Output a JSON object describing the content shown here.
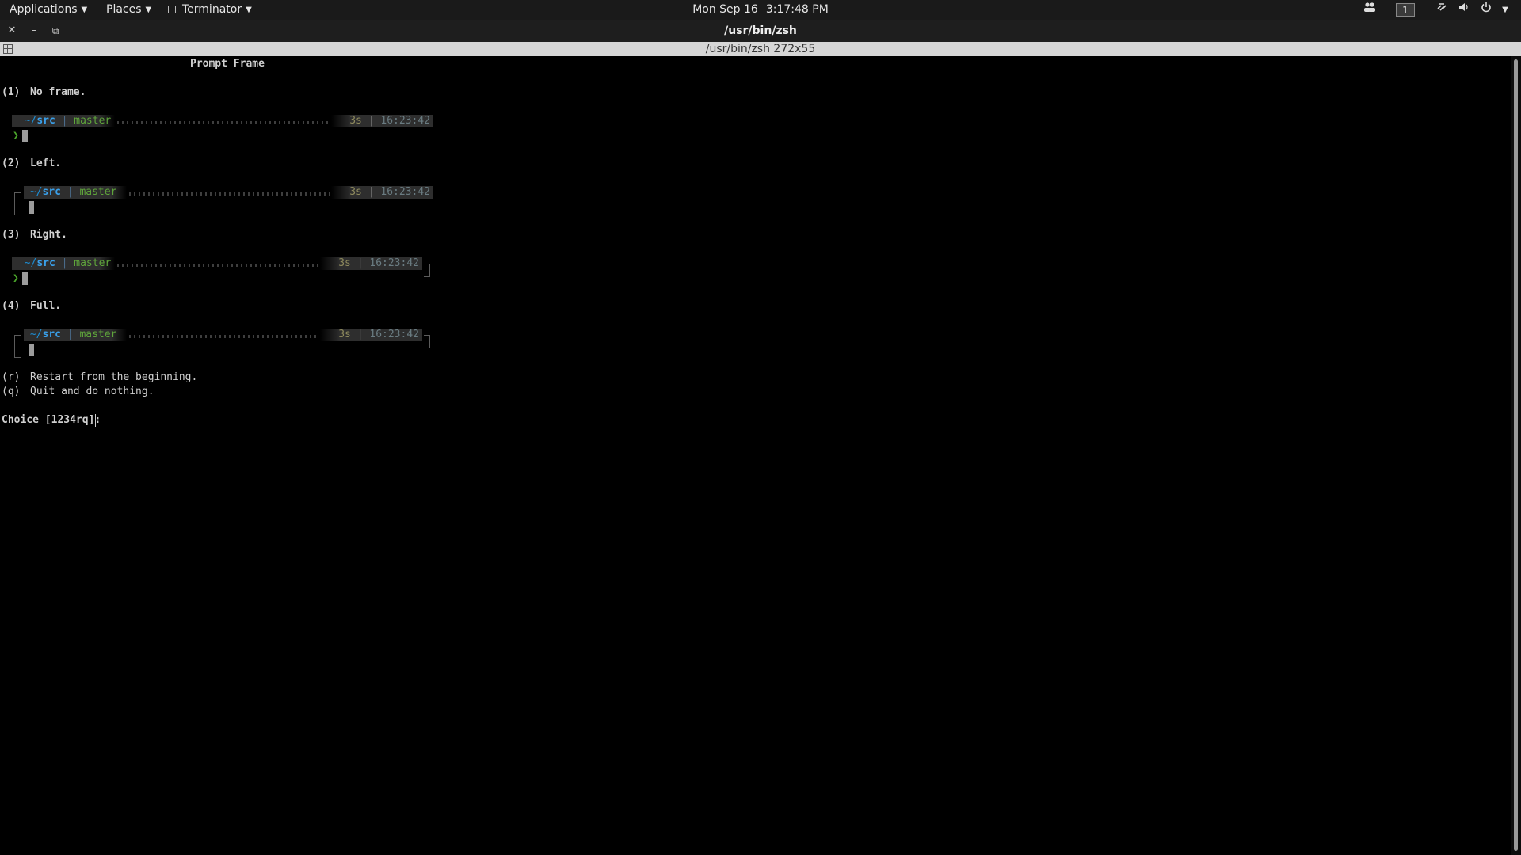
{
  "panel": {
    "applications_label": "Applications",
    "places_label": "Places",
    "app_label": "Terminator",
    "date": "Mon Sep 16",
    "time": "3:17:48 PM",
    "workspace": "1"
  },
  "window": {
    "title": "/usr/bin/zsh",
    "terminal_title": "/usr/bin/zsh 272x55"
  },
  "terminal": {
    "header": "Prompt Frame",
    "options": [
      {
        "key": "(1)",
        "label": "No frame."
      },
      {
        "key": "(2)",
        "label": "Left."
      },
      {
        "key": "(3)",
        "label": "Right."
      },
      {
        "key": "(4)",
        "label": "Full."
      }
    ],
    "prompt": {
      "dir_prefix": "~/",
      "dir": "src",
      "separator": "|",
      "branch": "master",
      "duration": "3s",
      "clock": "16:23:42",
      "chevron": "❯"
    },
    "extra_options": [
      {
        "key": "(r)",
        "label": "Restart from the beginning."
      },
      {
        "key": "(q)",
        "label": "Quit and do nothing."
      }
    ],
    "choice_prompt": "Choice [1234rq]:"
  }
}
